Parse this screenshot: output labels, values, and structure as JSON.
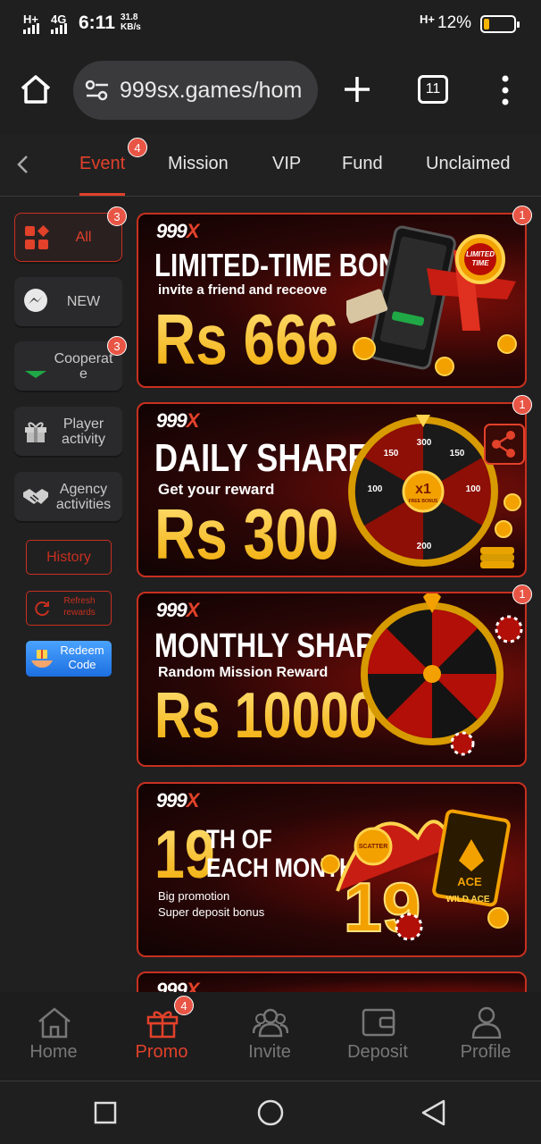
{
  "status_bar": {
    "signal_1": "H+",
    "signal_2": "4G",
    "time": "6:11",
    "speed_value": "31.8",
    "speed_unit": "KB/s",
    "signal_3": "H+",
    "battery": "12%"
  },
  "browser": {
    "url": "999sx.games/hom",
    "tab_count": "11"
  },
  "top_tabs": [
    {
      "label": "Event",
      "badge": "4"
    },
    {
      "label": "Mission"
    },
    {
      "label": "VIP"
    },
    {
      "label": "Fund"
    },
    {
      "label": "Unclaimed"
    }
  ],
  "sidebar": {
    "items": [
      {
        "label": "All",
        "badge": "3",
        "icon": "grid-icon"
      },
      {
        "label": "NEW",
        "icon": "messenger-icon"
      },
      {
        "label": "Cooperat e",
        "badge": "3",
        "icon": "green-chevron-icon"
      },
      {
        "label": "Player activity",
        "icon": "gift-icon"
      },
      {
        "label": "Agency activities",
        "icon": "handshake-icon"
      }
    ],
    "history": "History",
    "refresh": "Refresh rewards",
    "redeem": "Redeem Code"
  },
  "banners": [
    {
      "logo": "999X",
      "title": "LIMITED-TIME BONUS",
      "subtitle": "invite a friend and receove",
      "amount": "Rs 666",
      "stamp": "LIMITED TIME",
      "badge": "1"
    },
    {
      "logo": "999X",
      "title": "DAILY SHARE",
      "title_mark": "④",
      "subtitle": "Get your reward",
      "amount": "Rs 300",
      "wheel_center": "x1",
      "wheel_center_sub": "FREE BONUS",
      "wheel_labels": [
        "300",
        "150",
        "100",
        "200",
        "100",
        "150"
      ],
      "badge": "1"
    },
    {
      "logo": "999X",
      "title": "MONTHLY SHARING",
      "subtitle": "Random Mission Reward",
      "amount": "Rs 10000",
      "badge": "1"
    },
    {
      "logo": "999X",
      "title_num": "19",
      "title_line1": "TH OF",
      "title_line2": "EACH MONTH",
      "line1": "Big promotion",
      "line2": "Super deposit bonus",
      "art_num": "19",
      "card_text": "ACE",
      "card_text_2": "WILD ACE",
      "chip_text": "SCATTER"
    }
  ],
  "bottom_nav": [
    {
      "label": "Home"
    },
    {
      "label": "Promo",
      "badge": "4"
    },
    {
      "label": "Invite"
    },
    {
      "label": "Deposit"
    },
    {
      "label": "Profile"
    }
  ],
  "colors": {
    "accent": "#e2412a",
    "background": "#202021",
    "gold": "#f8c21b"
  }
}
